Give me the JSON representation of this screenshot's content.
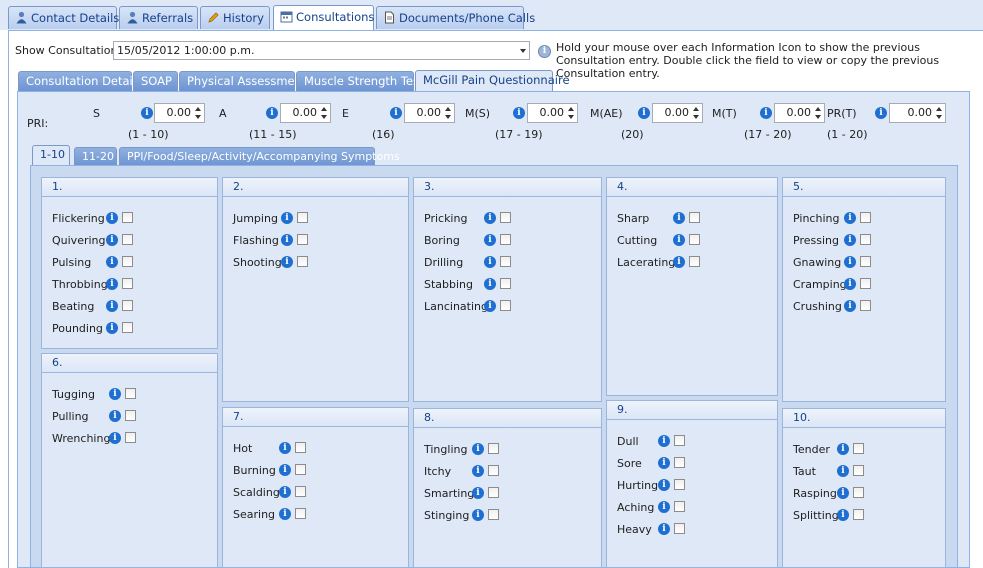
{
  "top_tabs": [
    {
      "label": "Contact Details",
      "icon": "person-icon"
    },
    {
      "label": "Referrals",
      "icon": "person-icon"
    },
    {
      "label": "History",
      "icon": "pencil-icon"
    },
    {
      "label": "Consultations",
      "icon": "calendar-icon"
    },
    {
      "label": "Documents/Phone Calls",
      "icon": "document-icon"
    }
  ],
  "consultation": {
    "show_label": "Show Consultation:",
    "selected": "15/05/2012 1:00:00 p.m.",
    "hint": "Hold your mouse over each Information Icon to show the previous Consultation entry. Double click the field to view or copy the previous Consultation entry."
  },
  "sub_tabs": [
    "Consultation Details",
    "SOAP",
    "Physical Assessment",
    "Muscle Strength Test",
    "McGill Pain Questionnaire"
  ],
  "pri": {
    "label": "PRI:",
    "fields": [
      {
        "name": "S",
        "value": "0.00",
        "range": "(1 - 10)"
      },
      {
        "name": "A",
        "value": "0.00",
        "range": "(11 - 15)"
      },
      {
        "name": "E",
        "value": "0.00",
        "range": "(16)"
      },
      {
        "name": "M(S)",
        "value": "0.00",
        "range": "(17 - 19)"
      },
      {
        "name": "M(AE)",
        "value": "0.00",
        "range": "(20)"
      },
      {
        "name": "M(T)",
        "value": "0.00",
        "range": "(17 - 20)"
      },
      {
        "name": "PR(T)",
        "value": "0.00",
        "range": "(1 - 20)"
      }
    ]
  },
  "inner_tabs": [
    "1-10",
    "11-20",
    "PPI/Food/Sleep/Activity/Accompanying Symptoms"
  ],
  "groups": [
    {
      "title": "1.",
      "items": [
        "Flickering",
        "Quivering",
        "Pulsing",
        "Throbbing",
        "Beating",
        "Pounding"
      ]
    },
    {
      "title": "2.",
      "items": [
        "Jumping",
        "Flashing",
        "Shooting"
      ]
    },
    {
      "title": "3.",
      "items": [
        "Pricking",
        "Boring",
        "Drilling",
        "Stabbing",
        "Lancinating"
      ]
    },
    {
      "title": "4.",
      "items": [
        "Sharp",
        "Cutting",
        "Lacerating"
      ]
    },
    {
      "title": "5.",
      "items": [
        "Pinching",
        "Pressing",
        "Gnawing",
        "Cramping",
        "Crushing"
      ]
    },
    {
      "title": "6.",
      "items": [
        "Tugging",
        "Pulling",
        "Wrenching"
      ]
    },
    {
      "title": "7.",
      "items": [
        "Hot",
        "Burning",
        "Scalding",
        "Searing"
      ]
    },
    {
      "title": "8.",
      "items": [
        "Tingling",
        "Itchy",
        "Smarting",
        "Stinging"
      ]
    },
    {
      "title": "9.",
      "items": [
        "Dull",
        "Sore",
        "Hurting",
        "Aching",
        "Heavy"
      ]
    },
    {
      "title": "10.",
      "items": [
        "Tender",
        "Taut",
        "Rasping",
        "Splitting"
      ]
    }
  ]
}
